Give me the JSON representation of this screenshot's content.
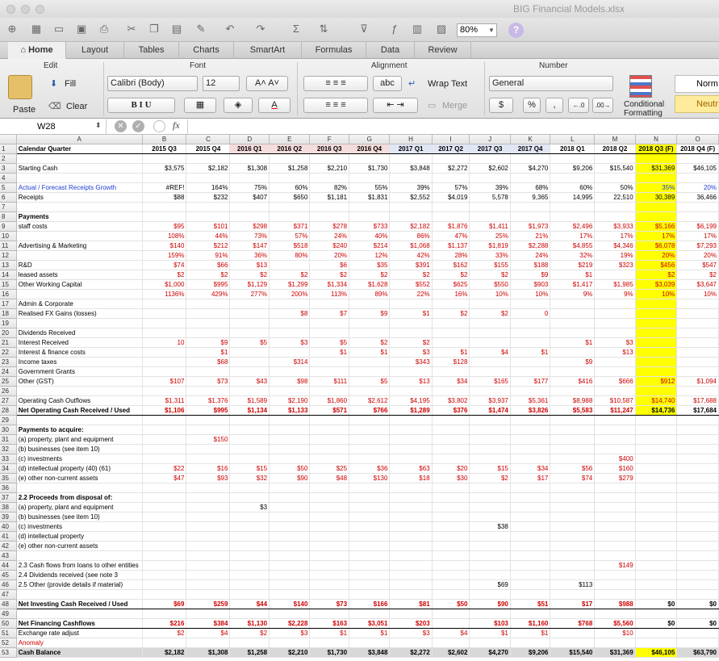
{
  "window": {
    "title": "BIG Financial Models.xlsx"
  },
  "toolbar": {
    "zoom": "80%"
  },
  "tabs": [
    "Home",
    "Layout",
    "Tables",
    "Charts",
    "SmartArt",
    "Formulas",
    "Data",
    "Review"
  ],
  "ribbon": {
    "groups": {
      "edit": "Edit",
      "font": "Font",
      "alignment": "Alignment",
      "number": "Number"
    },
    "paste": "Paste",
    "fill": "Fill",
    "clear": "Clear",
    "font_name": "Calibri (Body)",
    "font_size": "12",
    "wrap_text": "Wrap Text",
    "merge": "Merge",
    "number_format": "General",
    "percent": "%",
    "comma": ",",
    "conditional": "Conditional",
    "formatting": "Formatting",
    "style_normal": "Norm",
    "style_neutral": "Neutr",
    "abc": "abc"
  },
  "formula_bar": {
    "name_box": "W28",
    "fx": "fx"
  },
  "colors": {
    "red": "#cc0000",
    "blue": "#1f3fd1",
    "highlight": "#ffff00"
  },
  "columns": [
    "",
    "A",
    "B",
    "C",
    "D",
    "E",
    "F",
    "G",
    "H",
    "I",
    "J",
    "K",
    "L",
    "M",
    "N",
    "O"
  ],
  "rows": [
    {
      "n": "1",
      "s": "hdr",
      "c": [
        "Calendar Quarter",
        "2015 Q3",
        "2015 Q4",
        "2016 Q1",
        "2016 Q2",
        "2016 Q3",
        "2016 Q4",
        "2017 Q1",
        "2017 Q2",
        "2017 Q3",
        "2017 Q4",
        "2018 Q1",
        "2018 Q2",
        "2018 Q3 (F)",
        "2018 Q4 (F)"
      ]
    },
    {
      "n": "2",
      "c": []
    },
    {
      "n": "3",
      "c": [
        "Starting Cash",
        "$3,575",
        "$2,182",
        "$1,308",
        "$1,258",
        "$2,210",
        "$1,730",
        "$3,848",
        "$2,272",
        "$2,602",
        "$4,270",
        "$9,206",
        "$15,540",
        "$31,369",
        "$46,105"
      ]
    },
    {
      "n": "4",
      "c": []
    },
    {
      "n": "5",
      "s": "blue",
      "c": [
        "Actual / Forecast Receipts Growth",
        "#REF!",
        "164%",
        "75%",
        "60%",
        "82%",
        "55%",
        "39%",
        "57%",
        "39%",
        "68%",
        "60%",
        "50%",
        "35%",
        "20%"
      ]
    },
    {
      "n": "6",
      "c": [
        "Receipts",
        "$88",
        "$232",
        "$407",
        "$650",
        "$1,181",
        "$1,831",
        "$2,552",
        "$4,019",
        "5,578",
        "9,365",
        "14,995",
        "22,510",
        "30,389",
        "36,466"
      ]
    },
    {
      "n": "7",
      "c": []
    },
    {
      "n": "8",
      "s": "bold",
      "c": [
        "Payments"
      ]
    },
    {
      "n": "9",
      "s": "red",
      "c": [
        "staff costs",
        "$95",
        "$101",
        "$298",
        "$371",
        "$278",
        "$733",
        "$2,182",
        "$1,876",
        "$1,411",
        "$1,973",
        "$2,496",
        "$3,933",
        "$5,166",
        "$6,199"
      ]
    },
    {
      "n": "10",
      "c": [
        "",
        "108%",
        "44%",
        "73%",
        "57%",
        "24%",
        "40%",
        "86%",
        "47%",
        "25%",
        "21%",
        "17%",
        "17%",
        "17%",
        "17%"
      ]
    },
    {
      "n": "11",
      "s": "red",
      "c": [
        "Advertising & Marketing",
        "$140",
        "$212",
        "$147",
        "$518",
        "$240",
        "$214",
        "$1,068",
        "$1,137",
        "$1,819",
        "$2,288",
        "$4,855",
        "$4,346",
        "$6,078",
        "$7,293"
      ]
    },
    {
      "n": "12",
      "c": [
        "",
        "159%",
        "91%",
        "36%",
        "80%",
        "20%",
        "12%",
        "42%",
        "28%",
        "33%",
        "24%",
        "32%",
        "19%",
        "20%",
        "20%"
      ]
    },
    {
      "n": "13",
      "s": "red",
      "c": [
        "R&D",
        "$74",
        "$66",
        "$13",
        "",
        "$6",
        "$35",
        "$391",
        "$162",
        "$155",
        "$188",
        "$219",
        "$323",
        "$456",
        "$547"
      ]
    },
    {
      "n": "14",
      "s": "red",
      "c": [
        "leased assets",
        "$2",
        "$2",
        "$2",
        "$2",
        "$2",
        "$2",
        "$2",
        "$2",
        "$2",
        "$9",
        "$1",
        "",
        "$2",
        "$2"
      ]
    },
    {
      "n": "15",
      "s": "red",
      "c": [
        "Other Working Capital",
        "$1,000",
        "$995",
        "$1,129",
        "$1,299",
        "$1,334",
        "$1,628",
        "$552",
        "$625",
        "$550",
        "$903",
        "$1,417",
        "$1,985",
        "$3,039",
        "$3,647"
      ]
    },
    {
      "n": "16",
      "c": [
        "",
        "1136%",
        "429%",
        "277%",
        "200%",
        "113%",
        "89%",
        "22%",
        "16%",
        "10%",
        "10%",
        "9%",
        "9%",
        "10%",
        "10%"
      ]
    },
    {
      "n": "17",
      "c": [
        "Admin & Corporate"
      ]
    },
    {
      "n": "18",
      "s": "red",
      "c": [
        "Realised FX Gains (losses)",
        "",
        "",
        "",
        "$8",
        "$7",
        "$9",
        "$1",
        "$2",
        "$2",
        "0",
        "",
        "",
        "",
        ""
      ]
    },
    {
      "n": "19",
      "c": []
    },
    {
      "n": "20",
      "c": [
        "Dividends Received"
      ]
    },
    {
      "n": "21",
      "s": "red",
      "c": [
        "Interest Received",
        "10",
        "$9",
        "$5",
        "$3",
        "$5",
        "$2",
        "$2",
        "",
        "",
        "",
        "$1",
        "$3",
        "",
        ""
      ]
    },
    {
      "n": "22",
      "s": "red",
      "c": [
        "Interest & finance costs",
        "",
        "$1",
        "",
        "",
        "$1",
        "$1",
        "$3",
        "$1",
        "$4",
        "$1",
        "",
        "$13",
        "",
        ""
      ]
    },
    {
      "n": "23",
      "s": "red",
      "c": [
        "Income taxes",
        "",
        "$68",
        "",
        "$314",
        "",
        "",
        "$343",
        "$128",
        "",
        "",
        "$9",
        "",
        "",
        ""
      ]
    },
    {
      "n": "24",
      "c": [
        "Government Grants"
      ]
    },
    {
      "n": "25",
      "s": "red",
      "c": [
        "Other (GST)",
        "$107",
        "$73",
        "$43",
        "$98",
        "$111",
        "$5",
        "$13",
        "$34",
        "$165",
        "$177",
        "$416",
        "$666",
        "$912",
        "$1,094"
      ]
    },
    {
      "n": "26",
      "c": []
    },
    {
      "n": "27",
      "s": "red",
      "c": [
        "Operating Cash Outflows",
        "$1,311",
        "$1,376",
        "$1,589",
        "$2,190",
        "$1,860",
        "$2,612",
        "$4,195",
        "$3,802",
        "$3,937",
        "$5,361",
        "$8,988",
        "$10,587",
        "$14,740",
        "$17,688"
      ]
    },
    {
      "n": "28",
      "s": "boldnet",
      "c": [
        "Net Operating Cash Received / Used",
        "$1,106",
        "$995",
        "$1,134",
        "$1,133",
        "$571",
        "$766",
        "$1,289",
        "$376",
        "$1,474",
        "$3,826",
        "$5,583",
        "$11,247",
        "$14,736",
        "$17,684"
      ]
    },
    {
      "n": "29",
      "c": []
    },
    {
      "n": "30",
      "s": "bold",
      "c": [
        "Payments to acquire:"
      ]
    },
    {
      "n": "31",
      "s": "red",
      "c": [
        "(a) property, plant and equipment",
        "",
        "$150"
      ]
    },
    {
      "n": "32",
      "c": [
        "(b) businesses (see item 10)"
      ]
    },
    {
      "n": "33",
      "s": "red",
      "c": [
        "(c) investments",
        "",
        "",
        "",
        "",
        "",
        "",
        "",
        "",
        "",
        "",
        "",
        "$400",
        "",
        ""
      ]
    },
    {
      "n": "34",
      "s": "red",
      "c": [
        "(d) intellectual property (40) (61)",
        "$22",
        "$16",
        "$15",
        "$50",
        "$25",
        "$36",
        "$63",
        "$20",
        "$15",
        "$34",
        "$56",
        "$160",
        "",
        ""
      ]
    },
    {
      "n": "35",
      "s": "red",
      "c": [
        "(e) other non-current assets",
        "$47",
        "$93",
        "$32",
        "$90",
        "$48",
        "$130",
        "$18",
        "$30",
        "$2",
        "$17",
        "$74",
        "$279",
        "",
        ""
      ]
    },
    {
      "n": "36",
      "c": []
    },
    {
      "n": "37",
      "s": "bold",
      "c": [
        "2.2 Proceeds from disposal of:"
      ]
    },
    {
      "n": "38",
      "c": [
        "(a) property, plant and equipment",
        "",
        "",
        "$3"
      ]
    },
    {
      "n": "39",
      "c": [
        "(b) businesses (see item 10)"
      ]
    },
    {
      "n": "40",
      "c": [
        "(c) investments",
        "",
        "",
        "",
        "",
        "",
        "",
        "",
        "",
        "$38"
      ]
    },
    {
      "n": "41",
      "c": [
        "(d) intellectual property"
      ]
    },
    {
      "n": "42",
      "c": [
        "(e) other non-current assets"
      ]
    },
    {
      "n": "43",
      "c": []
    },
    {
      "n": "44",
      "s": "red",
      "c": [
        "2.3 Cash flows from loans to other entities",
        "",
        "",
        "",
        "",
        "",
        "",
        "",
        "",
        "",
        "",
        "",
        "$149",
        "",
        ""
      ]
    },
    {
      "n": "45",
      "c": [
        "2.4 Dividends received (see note 3"
      ]
    },
    {
      "n": "46",
      "c": [
        "2.5 Other (provide details if material)",
        "",
        "",
        "",
        "",
        "",
        "",
        "",
        "",
        "$69",
        "",
        "$113",
        "",
        "",
        ""
      ]
    },
    {
      "n": "47",
      "c": []
    },
    {
      "n": "48",
      "s": "boldnet",
      "c": [
        "Net Investing Cash Received / Used",
        "$69",
        "$259",
        "$44",
        "$140",
        "$73",
        "$166",
        "$81",
        "$50",
        "$90",
        "$51",
        "$17",
        "$988",
        "$0",
        "$0"
      ]
    },
    {
      "n": "49",
      "c": []
    },
    {
      "n": "50",
      "s": "boldnet",
      "c": [
        "Net Financing Cashflows",
        "$216",
        "$384",
        "$1,130",
        "$2,228",
        "$163",
        "$3,051",
        "$203",
        "",
        "$103",
        "$1,160",
        "$768",
        "$5,560",
        "$0",
        "$0"
      ]
    },
    {
      "n": "51",
      "s": "red",
      "c": [
        "Exchange rate adjust",
        "$2",
        "$4",
        "$2",
        "$3",
        "$1",
        "$1",
        "$3",
        "$4",
        "$1",
        "$1",
        "",
        "$10",
        "",
        ""
      ]
    },
    {
      "n": "52",
      "s": "anomaly",
      "c": [
        "Anomaly"
      ]
    },
    {
      "n": "53",
      "s": "total",
      "c": [
        "Cash Balance",
        "$2,182",
        "$1,308",
        "$1,258",
        "$2,210",
        "$1,730",
        "$3,848",
        "$2,272",
        "$2,602",
        "$4,270",
        "$9,206",
        "$15,540",
        "$31,369",
        "$46,105",
        "$63,790"
      ]
    }
  ]
}
